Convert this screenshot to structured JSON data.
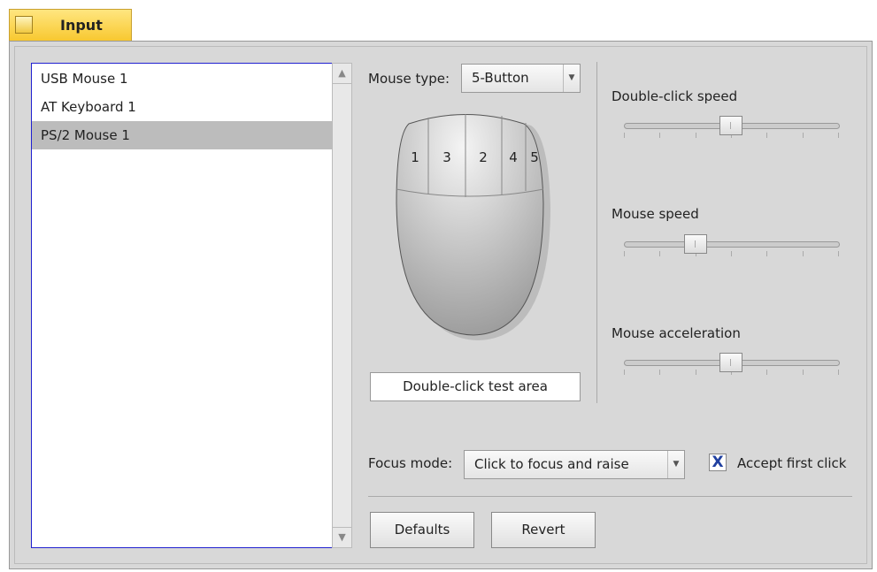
{
  "window": {
    "title": "Input"
  },
  "devices": {
    "items": [
      {
        "label": "USB Mouse 1",
        "selected": false
      },
      {
        "label": "AT Keyboard 1",
        "selected": false
      },
      {
        "label": "PS/2 Mouse 1",
        "selected": true
      }
    ]
  },
  "mouse": {
    "type_label": "Mouse type:",
    "type_value": "5-Button",
    "buttons": [
      "1",
      "3",
      "2",
      "4",
      "5"
    ],
    "test_area": "Double-click test area"
  },
  "sliders": [
    {
      "label": "Double-click speed",
      "value": 0.5,
      "ticks": 7
    },
    {
      "label": "Mouse speed",
      "value": 0.333,
      "ticks": 7
    },
    {
      "label": "Mouse acceleration",
      "value": 0.5,
      "ticks": 7
    }
  ],
  "focus": {
    "label": "Focus mode:",
    "value": "Click to focus and raise"
  },
  "accept_first_click": {
    "label": "Accept first click",
    "checked": true,
    "mark": "X"
  },
  "buttons": {
    "defaults": "Defaults",
    "revert": "Revert"
  }
}
